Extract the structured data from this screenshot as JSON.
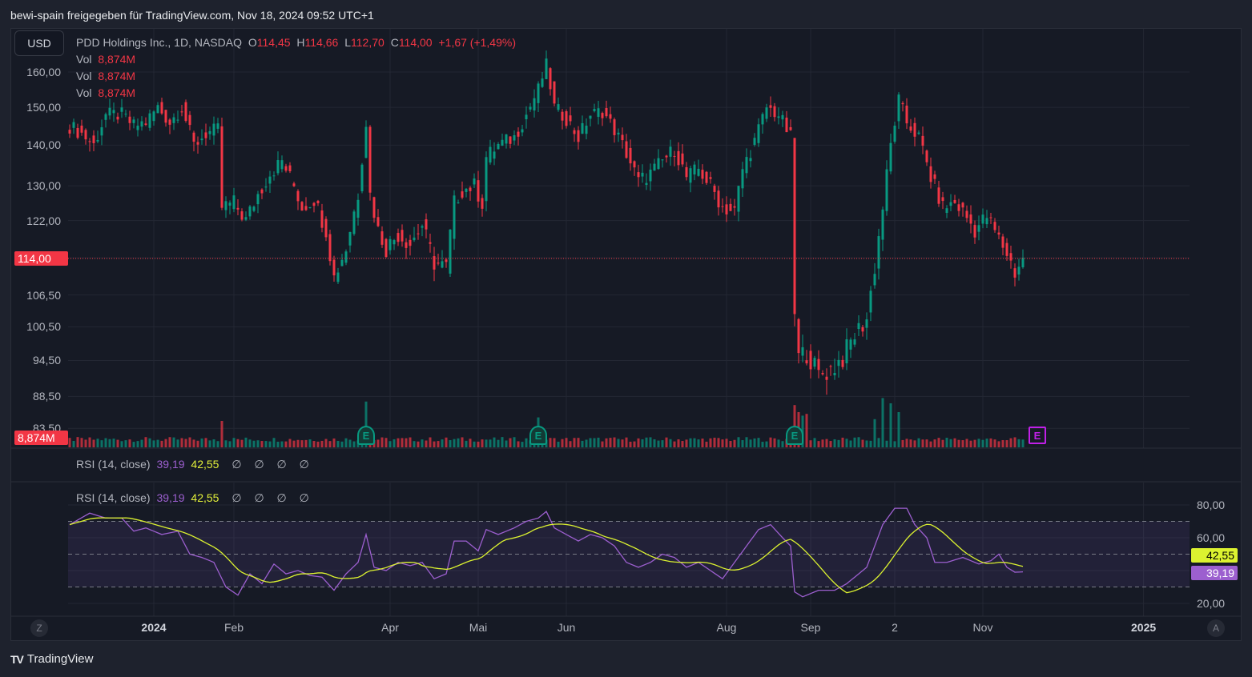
{
  "header": {
    "title": "bewi-spain freigegeben für TradingView.com, Nov 18, 2024 09:52 UTC+1"
  },
  "currency_button": "USD",
  "legend": {
    "symbol": "PDD Holdings Inc., 1D, NASDAQ",
    "o_label": "O",
    "o": "114,45",
    "h_label": "H",
    "h": "114,66",
    "l_label": "L",
    "l": "112,70",
    "c_label": "C",
    "c": "114,00",
    "change": "+1,67 (+1,49%)",
    "vol_rows": [
      {
        "label": "Vol",
        "value": "8,874M"
      },
      {
        "label": "Vol",
        "value": "8,874M"
      },
      {
        "label": "Vol",
        "value": "8,874M"
      }
    ]
  },
  "rsi_legend": {
    "title": "RSI (14, close)",
    "rsi": "39,19",
    "ma": "42,55",
    "na": [
      "∅",
      "∅",
      "∅",
      "∅"
    ]
  },
  "price_tags": {
    "last_price": "114,00",
    "last_volume": "8,874M",
    "rsi_ma": "42,55",
    "rsi": "39,19"
  },
  "scale_buttons": {
    "left": "Z",
    "right": "A"
  },
  "branding": "TradingView",
  "colors": {
    "up": "#089981",
    "down": "#f23645",
    "rsi": "#9c5fcf",
    "rsi_ma": "#dcf230",
    "earnings": "#089981",
    "earnings_upcoming": "#c020e8"
  },
  "chart_data": {
    "type": "candlestick",
    "title": "PDD Holdings Inc., 1D, NASDAQ",
    "scale": "log",
    "y_ticks": [
      "160,00",
      "150,00",
      "140,00",
      "130,00",
      "122,00",
      "114,00",
      "106,50",
      "100,50",
      "94,50",
      "88,50",
      "83,50"
    ],
    "y_tick_values": [
      160,
      150,
      140,
      130,
      122,
      114,
      106.5,
      100.5,
      94.5,
      88.5,
      83.5
    ],
    "x_ticks": [
      {
        "label": "2024",
        "bar": 21,
        "bold": true
      },
      {
        "label": "Feb",
        "bar": 41
      },
      {
        "label": "Apr",
        "bar": 80
      },
      {
        "label": "Mai",
        "bar": 102
      },
      {
        "label": "Jun",
        "bar": 124
      },
      {
        "label": "Aug",
        "bar": 164
      },
      {
        "label": "Sep",
        "bar": 185
      },
      {
        "label": "2",
        "bar": 206
      },
      {
        "label": "Nov",
        "bar": 228
      },
      {
        "label": "2025",
        "bar": 268,
        "bold": true
      }
    ],
    "close_keypoints": [
      [
        0,
        145
      ],
      [
        3,
        143
      ],
      [
        6,
        140
      ],
      [
        9,
        148
      ],
      [
        13,
        148
      ],
      [
        16,
        145
      ],
      [
        19,
        146
      ],
      [
        22,
        150
      ],
      [
        25,
        146
      ],
      [
        28,
        150
      ],
      [
        31,
        140
      ],
      [
        34,
        143
      ],
      [
        37,
        144
      ],
      [
        38,
        125
      ],
      [
        41,
        126
      ],
      [
        44,
        122
      ],
      [
        47,
        128
      ],
      [
        50,
        133
      ],
      [
        53,
        136
      ],
      [
        56,
        130
      ],
      [
        58,
        125
      ],
      [
        61,
        127
      ],
      [
        64,
        120
      ],
      [
        66,
        110
      ],
      [
        69,
        116
      ],
      [
        72,
        128
      ],
      [
        74,
        146
      ],
      [
        75,
        128
      ],
      [
        77,
        120
      ],
      [
        79,
        116
      ],
      [
        82,
        119
      ],
      [
        85,
        117
      ],
      [
        88,
        121
      ],
      [
        91,
        113
      ],
      [
        94,
        112
      ],
      [
        96,
        126
      ],
      [
        98,
        129
      ],
      [
        101,
        130
      ],
      [
        103,
        126
      ],
      [
        104,
        137
      ],
      [
        107,
        140
      ],
      [
        111,
        142
      ],
      [
        114,
        148
      ],
      [
        117,
        155
      ],
      [
        119,
        162
      ],
      [
        121,
        150
      ],
      [
        124,
        147
      ],
      [
        127,
        142
      ],
      [
        130,
        148
      ],
      [
        133,
        149
      ],
      [
        136,
        144
      ],
      [
        139,
        138
      ],
      [
        142,
        131
      ],
      [
        145,
        133
      ],
      [
        148,
        136
      ],
      [
        151,
        139
      ],
      [
        154,
        132
      ],
      [
        157,
        134
      ],
      [
        160,
        130
      ],
      [
        163,
        125
      ],
      [
        166,
        124
      ],
      [
        168,
        134
      ],
      [
        171,
        141
      ],
      [
        174,
        150
      ],
      [
        177,
        148
      ],
      [
        180,
        142
      ],
      [
        181,
        103
      ],
      [
        182,
        95
      ],
      [
        184,
        96
      ],
      [
        187,
        92
      ],
      [
        190,
        93
      ],
      [
        193,
        95
      ],
      [
        196,
        99
      ],
      [
        199,
        102
      ],
      [
        201,
        112
      ],
      [
        203,
        125
      ],
      [
        205,
        140
      ],
      [
        207,
        152
      ],
      [
        209,
        146
      ],
      [
        212,
        142
      ],
      [
        215,
        132
      ],
      [
        218,
        125
      ],
      [
        221,
        126
      ],
      [
        223,
        124
      ],
      [
        226,
        120
      ],
      [
        229,
        123
      ],
      [
        232,
        118
      ],
      [
        234,
        115
      ],
      [
        236,
        111
      ],
      [
        238,
        114
      ]
    ],
    "volume_base_M": 9,
    "volume_spikes_M": [
      [
        38,
        30
      ],
      [
        74,
        52
      ],
      [
        117,
        34
      ],
      [
        181,
        48
      ],
      [
        182,
        40
      ],
      [
        183,
        36
      ],
      [
        184,
        38
      ],
      [
        201,
        32
      ],
      [
        203,
        56
      ],
      [
        205,
        50
      ],
      [
        207,
        40
      ]
    ],
    "last_volume_M": 8.874,
    "earnings_bars": [
      74,
      117,
      181
    ],
    "upcoming_earnings_bar": 246,
    "earnings_label": "E",
    "rsi": {
      "period": 14,
      "ylim": [
        20,
        80
      ],
      "y_ticks": [
        "80,00",
        "60,00",
        "20,00"
      ],
      "y_tick_values": [
        80,
        60,
        20
      ],
      "bands": [
        70,
        50,
        30
      ],
      "keypoints": [
        [
          0,
          68
        ],
        [
          5,
          75
        ],
        [
          9,
          72
        ],
        [
          13,
          72
        ],
        [
          16,
          64
        ],
        [
          19,
          66
        ],
        [
          23,
          62
        ],
        [
          27,
          64
        ],
        [
          30,
          50
        ],
        [
          33,
          48
        ],
        [
          36,
          45
        ],
        [
          39,
          30
        ],
        [
          42,
          25
        ],
        [
          45,
          38
        ],
        [
          48,
          32
        ],
        [
          51,
          44
        ],
        [
          54,
          38
        ],
        [
          57,
          40
        ],
        [
          60,
          37
        ],
        [
          63,
          36
        ],
        [
          66,
          28
        ],
        [
          69,
          38
        ],
        [
          72,
          45
        ],
        [
          74,
          62
        ],
        [
          76,
          42
        ],
        [
          79,
          40
        ],
        [
          82,
          45
        ],
        [
          85,
          43
        ],
        [
          88,
          45
        ],
        [
          91,
          35
        ],
        [
          94,
          38
        ],
        [
          96,
          58
        ],
        [
          99,
          58
        ],
        [
          102,
          52
        ],
        [
          104,
          65
        ],
        [
          107,
          62
        ],
        [
          111,
          66
        ],
        [
          114,
          70
        ],
        [
          117,
          72
        ],
        [
          119,
          76
        ],
        [
          121,
          66
        ],
        [
          124,
          62
        ],
        [
          127,
          58
        ],
        [
          130,
          62
        ],
        [
          133,
          60
        ],
        [
          136,
          55
        ],
        [
          139,
          45
        ],
        [
          142,
          42
        ],
        [
          145,
          45
        ],
        [
          148,
          50
        ],
        [
          151,
          48
        ],
        [
          154,
          42
        ],
        [
          157,
          45
        ],
        [
          160,
          40
        ],
        [
          163,
          35
        ],
        [
          166,
          45
        ],
        [
          169,
          55
        ],
        [
          172,
          65
        ],
        [
          175,
          68
        ],
        [
          178,
          60
        ],
        [
          180,
          55
        ],
        [
          181,
          27
        ],
        [
          183,
          24
        ],
        [
          187,
          28
        ],
        [
          191,
          28
        ],
        [
          194,
          32
        ],
        [
          197,
          38
        ],
        [
          199,
          42
        ],
        [
          201,
          55
        ],
        [
          203,
          68
        ],
        [
          206,
          78
        ],
        [
          209,
          78
        ],
        [
          211,
          68
        ],
        [
          214,
          60
        ],
        [
          216,
          45
        ],
        [
          219,
          45
        ],
        [
          223,
          48
        ],
        [
          227,
          44
        ],
        [
          230,
          46
        ],
        [
          232,
          50
        ],
        [
          234,
          42
        ],
        [
          236,
          39
        ],
        [
          238,
          39.19
        ]
      ],
      "last_rsi": 39.19,
      "last_ma": 42.55
    }
  }
}
